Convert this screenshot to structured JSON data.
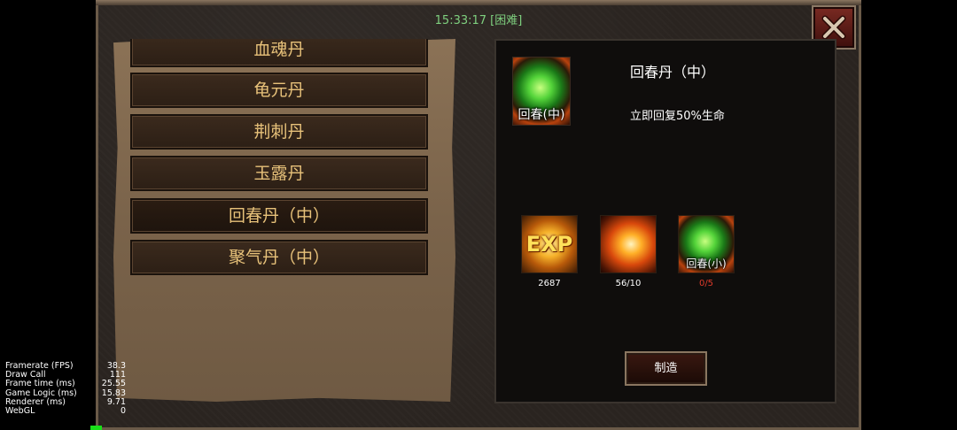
{
  "header": {
    "clock": "15:33:17 [困难]"
  },
  "list": {
    "items": [
      {
        "label": "血魂丹"
      },
      {
        "label": "龟元丹"
      },
      {
        "label": "荆刺丹"
      },
      {
        "label": "玉露丹"
      },
      {
        "label": "回春丹（中）",
        "selected": true
      },
      {
        "label": "聚气丹（中）"
      }
    ]
  },
  "detail": {
    "icon_label": "回春(中)",
    "title": "回春丹（中）",
    "description": "立即回复50%生命",
    "materials": [
      {
        "icon": "exp-icon",
        "glyph": "EXP",
        "count": "2687",
        "sufficient": true
      },
      {
        "icon": "flame-icon",
        "count": "56/10",
        "sufficient": true
      },
      {
        "icon": "green-orb-icon",
        "label": "回春(小)",
        "count": "0/5",
        "sufficient": false
      }
    ],
    "make_button": "制造"
  },
  "stats": [
    {
      "label": "Framerate (FPS)",
      "value": "38.3"
    },
    {
      "label": "Draw Call",
      "value": "111"
    },
    {
      "label": "Frame time (ms)",
      "value": "25.55"
    },
    {
      "label": "Game Logic (ms)",
      "value": "15.83"
    },
    {
      "label": "Renderer (ms)",
      "value": "9.71"
    },
    {
      "label": "WebGL",
      "value": "0"
    }
  ],
  "colors": {
    "accent_text": "#e8c27a",
    "clock": "#7fd07f",
    "insufficient": "#e03a2a"
  }
}
